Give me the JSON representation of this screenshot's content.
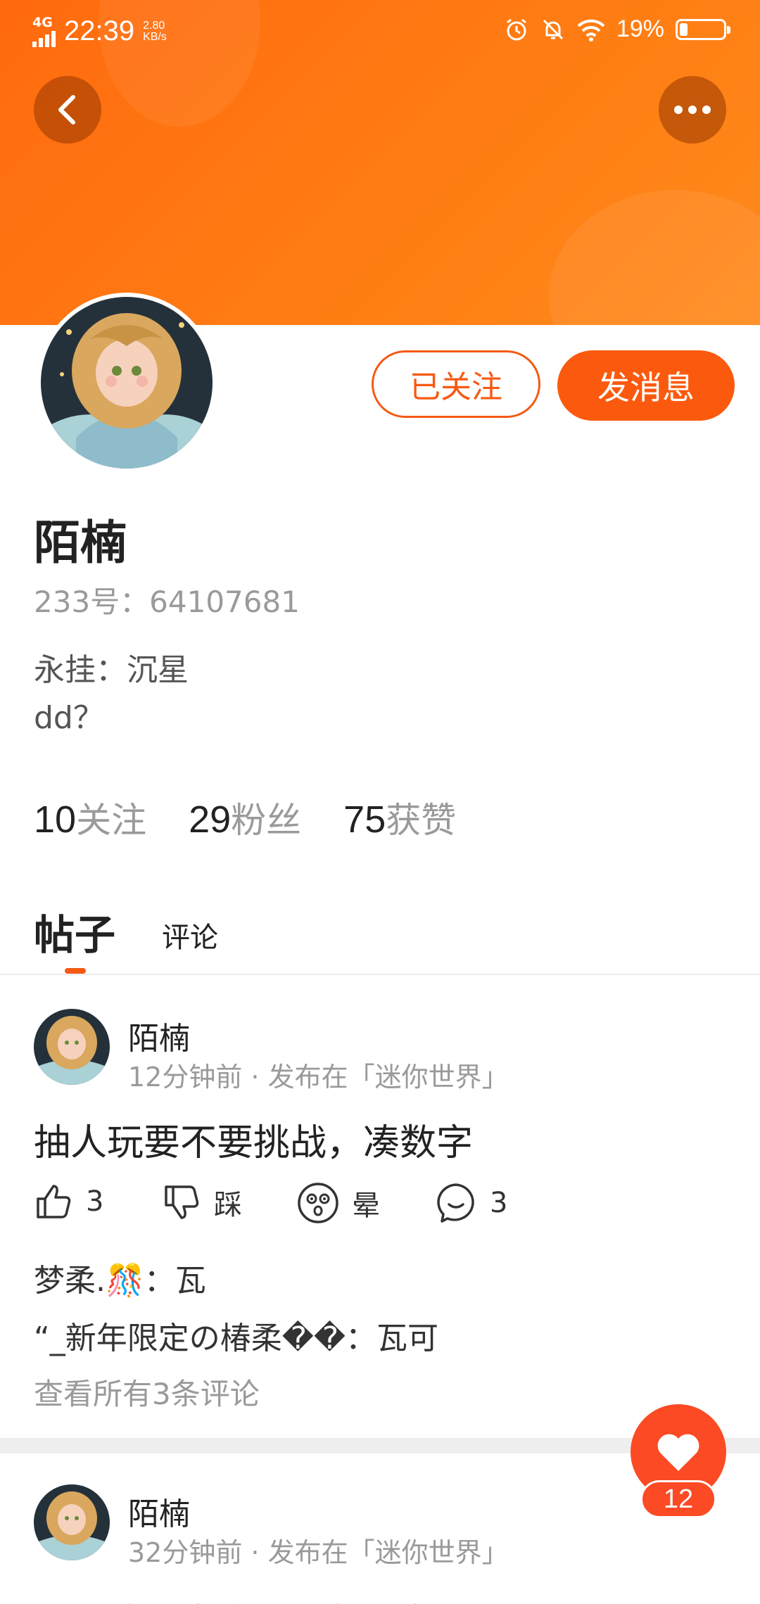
{
  "status_bar": {
    "network": "4G",
    "time": "22:39",
    "speed_value": "2.80",
    "speed_unit": "KB/s",
    "battery": "19%",
    "battery_level": 0.19
  },
  "profile": {
    "name": "陌楠",
    "uid": "233号：64107681",
    "bio_line1": "永挂：沉星",
    "bio_line2": "dd？",
    "follow_label": "已关注",
    "message_label": "发消息"
  },
  "stats": [
    {
      "num": "10",
      "label": "关注"
    },
    {
      "num": "29",
      "label": "粉丝"
    },
    {
      "num": "75",
      "label": "获赞"
    }
  ],
  "tabs": {
    "posts": "帖子",
    "comments": "评论"
  },
  "posts": [
    {
      "author": "陌楠",
      "meta": "12分钟前 · 发布在「迷你世界」",
      "title": "抽人玩要不要挑战，凑数字",
      "likes": "3",
      "dislike_label": "踩",
      "dizzy_label": "晕",
      "comments_count": "3",
      "comment1": "梦柔.🎊：瓦",
      "comment2": "“_新年限定の椿柔��：瓦可",
      "view_all": "查看所有3条评论"
    },
    {
      "author": "陌楠",
      "meta": "32分钟前 · 发布在「迷你世界」",
      "title_partial": "我想建个家族，求帮取名"
    }
  ],
  "fab": {
    "count": "12"
  },
  "colors": {
    "brand": "#fb5a0e",
    "banner": "#ff7312",
    "fab": "#fb4a24"
  }
}
